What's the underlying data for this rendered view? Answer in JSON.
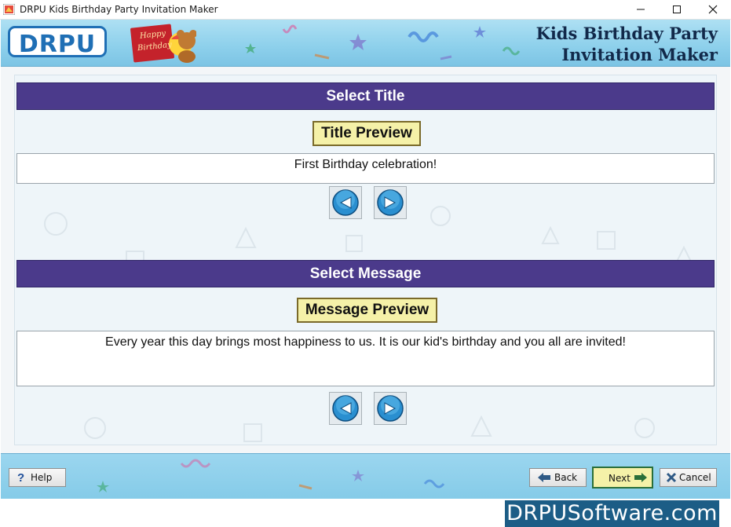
{
  "window": {
    "title": "DRPU Kids Birthday Party Invitation Maker"
  },
  "banner": {
    "logo_text": "DRPU",
    "card_line1": "Happy",
    "card_line2": "Birthday",
    "app_name_line1": "Kids Birthday Party",
    "app_name_line2": "Invitation Maker"
  },
  "title_section": {
    "header": "Select Title",
    "preview_label": "Title Preview",
    "preview_text": "First Birthday celebration!"
  },
  "message_section": {
    "header": "Select Message",
    "preview_label": "Message Preview",
    "preview_text": "Every year this day brings most happiness to us. It is our kid's birthday and you all are invited!"
  },
  "footer": {
    "help_label": "Help",
    "back_label": "Back",
    "next_label": "Next",
    "cancel_label": "Cancel"
  },
  "watermark": "DRPUSoftware.com",
  "colors": {
    "section_header": "#4b3a8b",
    "preview_label_bg": "#f5f1a8",
    "banner": "#8fd1ec",
    "logo": "#1f6fb5"
  },
  "icons": {
    "prev": "arrow-left-circle-icon",
    "next": "arrow-right-circle-icon",
    "help": "question-icon",
    "back": "arrow-left-icon",
    "next_btn": "arrow-right-icon",
    "cancel": "x-icon"
  }
}
